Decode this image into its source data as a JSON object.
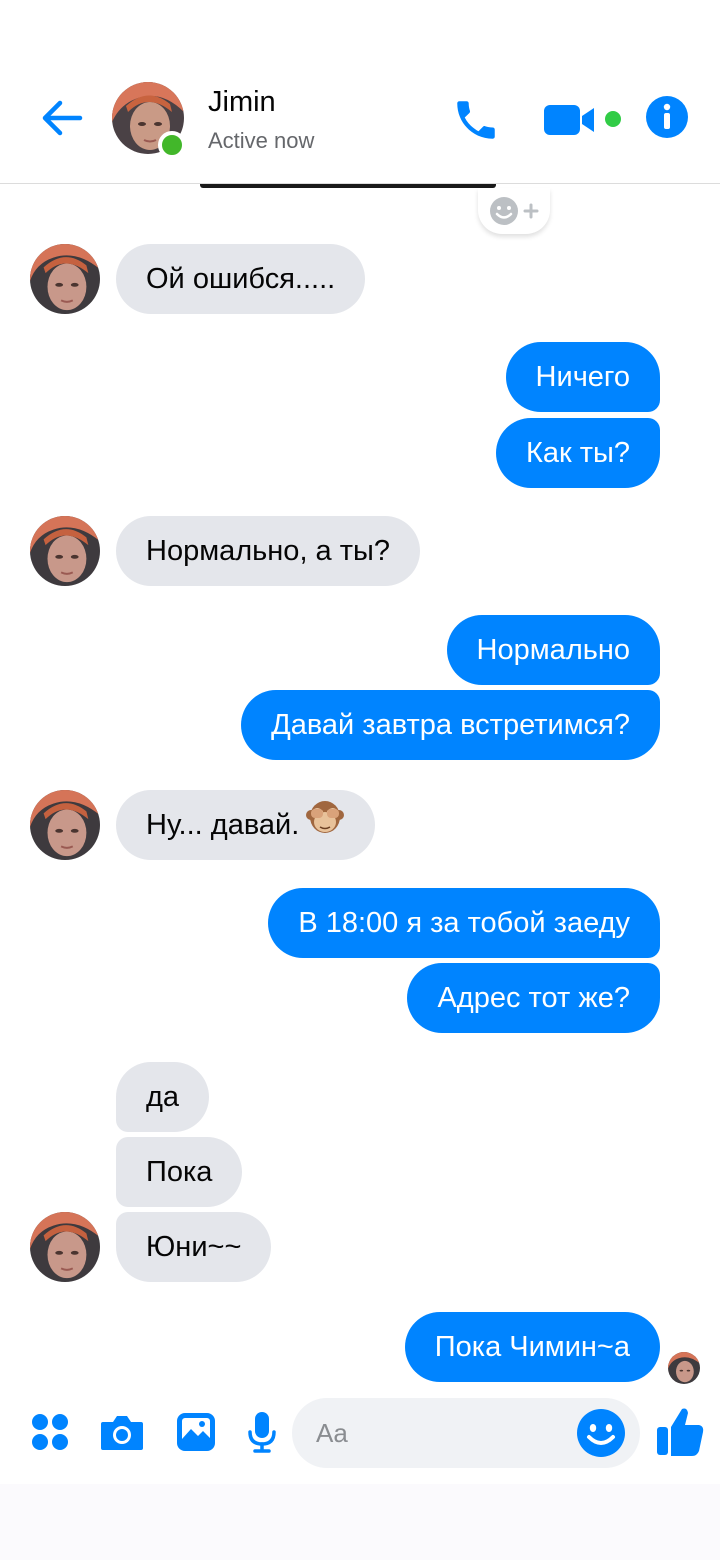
{
  "header": {
    "contact_name": "Jimin",
    "status": "Active now"
  },
  "colors": {
    "accent": "#0084ff",
    "incoming_bubble": "#e4e6eb",
    "online": "#42b72a"
  },
  "messages": [
    {
      "direction": "in",
      "text": "Ой ошибся....."
    },
    {
      "direction": "out",
      "text": "Ничего"
    },
    {
      "direction": "out",
      "text": "Как ты?"
    },
    {
      "direction": "in",
      "text": "Нормально, а ты?"
    },
    {
      "direction": "out",
      "text": "Нормально"
    },
    {
      "direction": "out",
      "text": "Давай завтра встретимся?"
    },
    {
      "direction": "in",
      "text": "Ну... давай.",
      "emoji": "see-no-evil-monkey"
    },
    {
      "direction": "out",
      "text": "В 18:00 я за тобой заеду"
    },
    {
      "direction": "out",
      "text": "Адрес тот же?"
    },
    {
      "direction": "in",
      "text": "да"
    },
    {
      "direction": "in",
      "text": "Пока"
    },
    {
      "direction": "in",
      "text": "Юни~~"
    },
    {
      "direction": "out",
      "text": "Пока Чимин~а"
    }
  ],
  "composer": {
    "placeholder": "Aa",
    "icons": [
      "apps-icon",
      "camera-icon",
      "gallery-icon",
      "microphone-icon",
      "emoji-icon",
      "thumbs-up-icon"
    ]
  }
}
